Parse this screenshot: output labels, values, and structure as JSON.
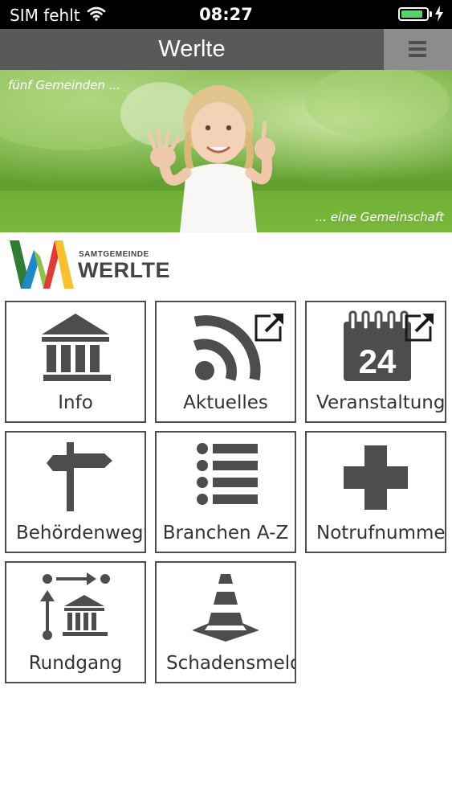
{
  "status_bar": {
    "carrier": "SIM fehlt",
    "time": "08:27",
    "battery_level": 0.85
  },
  "header": {
    "title": "Werlte"
  },
  "banner": {
    "left_text": "fünf Gemeinden ...",
    "right_text": "... eine Gemeinschaft"
  },
  "logo": {
    "small_text": "SAMTGEMEINDE",
    "big_text": "WERLTE"
  },
  "tiles": [
    {
      "label": "Info",
      "icon": "museum-icon",
      "external": false
    },
    {
      "label": "Aktuelles",
      "icon": "rss-icon",
      "external": true
    },
    {
      "label": "Veranstaltungen",
      "icon": "calendar-24-icon",
      "external": true
    },
    {
      "label": "Behördenwegweiser",
      "icon": "signpost-icon",
      "external": false
    },
    {
      "label": "Branchen A-Z",
      "icon": "list-icon",
      "external": false
    },
    {
      "label": "Notrufnummern",
      "icon": "medical-cross-icon",
      "external": false
    },
    {
      "label": "Rundgang",
      "icon": "tour-icon",
      "external": false
    },
    {
      "label": "Schadensmeldung",
      "icon": "traffic-cone-icon",
      "external": false
    }
  ],
  "calendar_number": "24",
  "colors": {
    "icon_gray": "#4d4d4d",
    "navbar": "#595959",
    "menu_button": "#8c8c8c",
    "battery_green": "#4cd964"
  }
}
